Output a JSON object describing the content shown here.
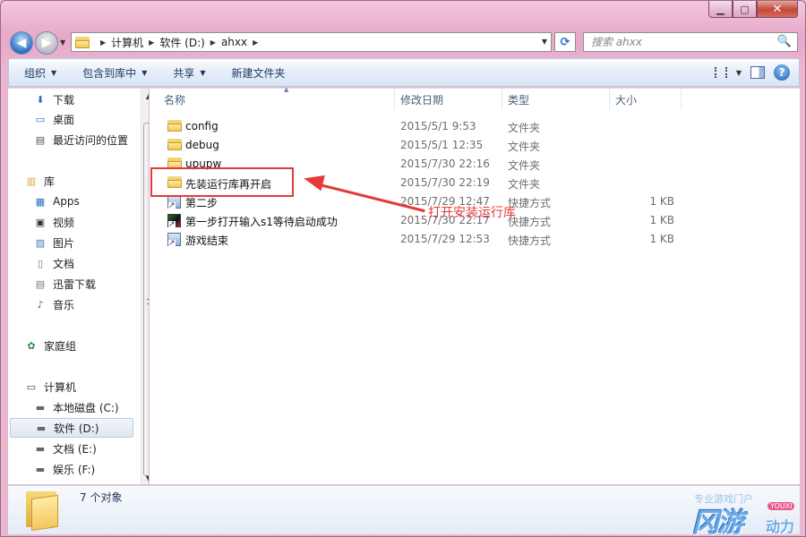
{
  "titlebar": {
    "min_glyph": "▁",
    "max_glyph": "▢",
    "close_glyph": "✕"
  },
  "address": {
    "crumbs": [
      "计算机",
      "软件 (D:)",
      "ahxx"
    ],
    "sep": "▶",
    "drop": "▼"
  },
  "nav_buttons": {
    "back": "◀",
    "forward": "▶",
    "dropdown": "▼",
    "refresh": "⟳"
  },
  "search": {
    "placeholder": "搜索 ahxx",
    "icon": "🔍"
  },
  "toolbar": {
    "organize": "组织",
    "include_in_library": "包含到库中",
    "share": "共享",
    "new_folder": "新建文件夹",
    "drop_arrow": "▼",
    "help": "?"
  },
  "navigation": {
    "items": [
      {
        "label": "下载",
        "icon": "download-folder-icon",
        "glyph": "⬇",
        "color": "#2a6cc4"
      },
      {
        "label": "桌面",
        "icon": "desktop-icon",
        "glyph": "▭",
        "color": "#2a6cc4"
      },
      {
        "label": "最近访问的位置",
        "icon": "recent-places-icon",
        "glyph": "▤",
        "color": "#555"
      },
      {
        "label": "库",
        "icon": "libraries-icon",
        "glyph": "▥",
        "color": "#d9a53a"
      },
      {
        "label": "Apps",
        "icon": "apps-library-icon",
        "glyph": "▦",
        "color": "#2a6cc4"
      },
      {
        "label": "视频",
        "icon": "videos-library-icon",
        "glyph": "▣",
        "color": "#333"
      },
      {
        "label": "图片",
        "icon": "pictures-library-icon",
        "glyph": "▨",
        "color": "#4a7bb8"
      },
      {
        "label": "文档",
        "icon": "documents-library-icon",
        "glyph": "▯",
        "color": "#777"
      },
      {
        "label": "迅雷下载",
        "icon": "thunder-download-icon",
        "glyph": "▤",
        "color": "#777"
      },
      {
        "label": "音乐",
        "icon": "music-library-icon",
        "glyph": "♪",
        "color": "#2a6cc4"
      },
      {
        "label": "家庭组",
        "icon": "homegroup-icon",
        "glyph": "✿",
        "color": "#2a8c4a"
      },
      {
        "label": "计算机",
        "icon": "computer-icon",
        "glyph": "▭",
        "color": "#444"
      },
      {
        "label": "本地磁盘 (C:)",
        "icon": "drive-c-icon",
        "glyph": "▬",
        "color": "#666"
      },
      {
        "label": "软件 (D:)",
        "icon": "drive-d-icon",
        "glyph": "▬",
        "color": "#666"
      },
      {
        "label": "文档 (E:)",
        "icon": "drive-e-icon",
        "glyph": "▬",
        "color": "#666"
      },
      {
        "label": "娱乐 (F:)",
        "icon": "drive-f-icon",
        "glyph": "▬",
        "color": "#666"
      }
    ],
    "selected": "软件 (D:)"
  },
  "scrollbar": {
    "up": "▲",
    "down": "▼"
  },
  "columns": {
    "name": "名称",
    "modified": "修改日期",
    "type": "类型",
    "size": "大小",
    "sort_indicator": "▲"
  },
  "files": [
    {
      "name": "config",
      "modified": "2015/5/1 9:53",
      "type": "文件夹",
      "size": "",
      "kind": "folder"
    },
    {
      "name": "debug",
      "modified": "2015/5/1 12:35",
      "type": "文件夹",
      "size": "",
      "kind": "folder"
    },
    {
      "name": "upupw",
      "modified": "2015/7/30 22:16",
      "type": "文件夹",
      "size": "",
      "kind": "folder"
    },
    {
      "name": "先装运行库再开启",
      "modified": "2015/7/30 22:19",
      "type": "文件夹",
      "size": "",
      "kind": "folder"
    },
    {
      "name": "第二步",
      "modified": "2015/7/29 12:47",
      "type": "快捷方式",
      "size": "1 KB",
      "kind": "shortcut"
    },
    {
      "name": "第一步打开输入s1等待启动成功",
      "modified": "2015/7/30 22:17",
      "type": "快捷方式",
      "size": "1 KB",
      "kind": "game-shortcut"
    },
    {
      "name": "游戏结束",
      "modified": "2015/7/29 12:53",
      "type": "快捷方式",
      "size": "1 KB",
      "kind": "shortcut"
    }
  ],
  "annotation": {
    "text": "打开安装运行库",
    "color": "#e43a3a"
  },
  "details": {
    "count": "7 个对象"
  },
  "watermark": {
    "main": "冈游",
    "top": "专业游戏门户",
    "badge": "YOUXI",
    "sub": "动力"
  }
}
